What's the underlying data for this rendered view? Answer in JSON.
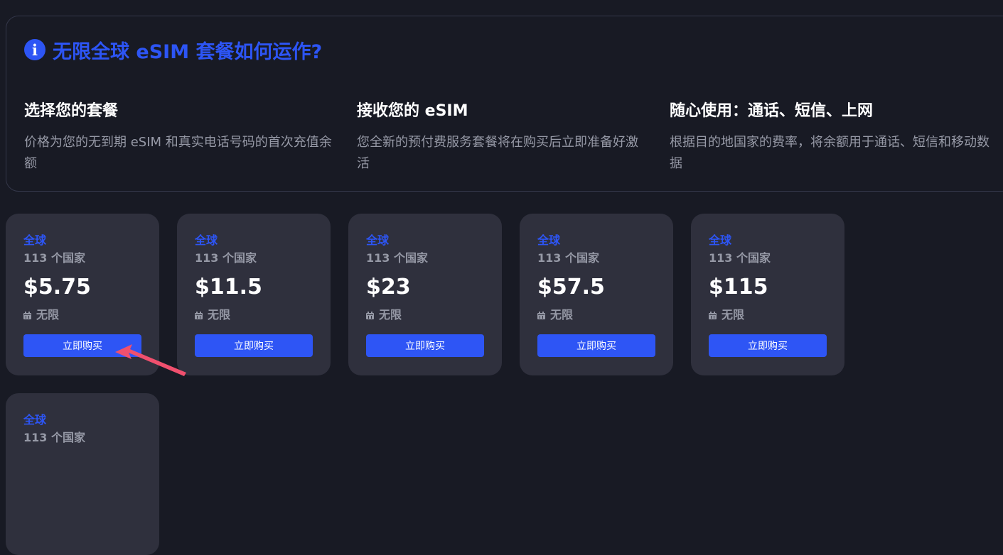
{
  "info": {
    "icon": "info-icon",
    "icon_glyph": "i",
    "title": "无限全球 eSIM 套餐如何运作?",
    "steps": [
      {
        "heading": "选择您的套餐",
        "description": "价格为您的无到期 eSIM 和真实电话号码的首次充值余额"
      },
      {
        "heading": "接收您的 eSIM",
        "description": "您全新的预付费服务套餐将在购买后立即准备好激活"
      },
      {
        "heading": "随心使用：通话、短信、上网",
        "description": "根据目的地国家的费率，将余额用于通话、短信和移动数据"
      }
    ]
  },
  "plans": [
    {
      "region": "全球",
      "countries": "113 个国家",
      "price": "$5.75",
      "validity": "无限",
      "buy_label": "立即购买"
    },
    {
      "region": "全球",
      "countries": "113 个国家",
      "price": "$11.5",
      "validity": "无限",
      "buy_label": "立即购买"
    },
    {
      "region": "全球",
      "countries": "113 个国家",
      "price": "$23",
      "validity": "无限",
      "buy_label": "立即购买"
    },
    {
      "region": "全球",
      "countries": "113 个国家",
      "price": "$57.5",
      "validity": "无限",
      "buy_label": "立即购买"
    },
    {
      "region": "全球",
      "countries": "113 个国家",
      "price": "$115",
      "validity": "无限",
      "buy_label": "立即购买"
    },
    {
      "region": "全球",
      "countries": "113 个国家",
      "price": "",
      "validity": "",
      "buy_label": ""
    }
  ],
  "colors": {
    "background": "#181a24",
    "card": "#2f303d",
    "accent": "#2d55f5",
    "muted_text": "#9699a6",
    "annotation_arrow": "#f0506e"
  }
}
